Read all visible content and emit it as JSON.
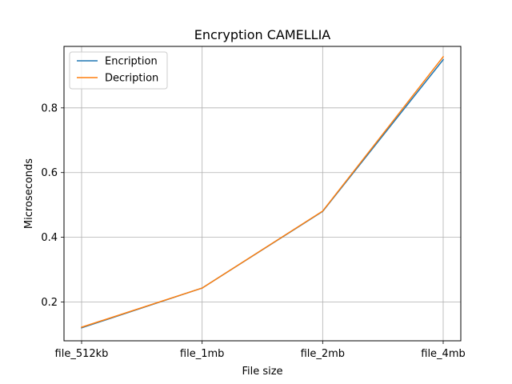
{
  "chart_data": {
    "type": "line",
    "title": "Encryption CAMELLIA",
    "xlabel": "File size",
    "ylabel": "Microseconds",
    "categories": [
      "file_512kb",
      "file_1mb",
      "file_2mb",
      "file_4mb"
    ],
    "ylim": [
      0.08,
      0.99
    ],
    "yticks": [
      0.2,
      0.4,
      0.6,
      0.8
    ],
    "ytick_labels": [
      "0.2",
      "0.4",
      "0.6",
      "0.8"
    ],
    "grid": true,
    "legend_position": "top-left",
    "series": [
      {
        "name": "Encription",
        "color": "#1f77b4",
        "values": [
          0.12,
          0.243,
          0.48,
          0.949
        ]
      },
      {
        "name": "Decription",
        "color": "#ff7f0e",
        "values": [
          0.122,
          0.243,
          0.481,
          0.958
        ]
      }
    ]
  }
}
